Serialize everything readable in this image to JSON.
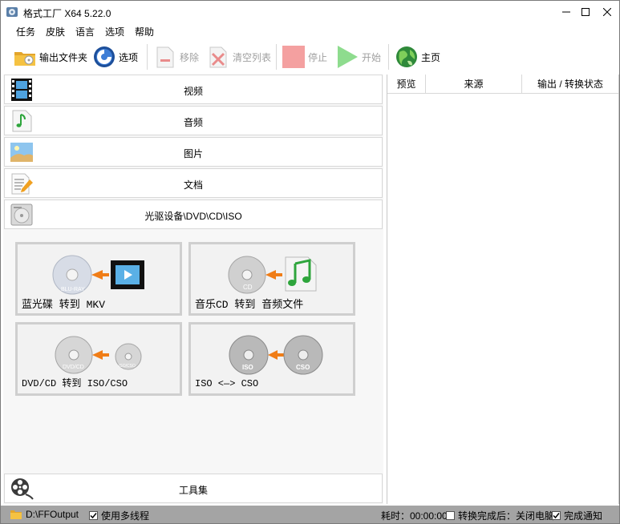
{
  "window": {
    "title": "格式工厂 X64 5.22.0",
    "controls": {
      "minimize": "minimize",
      "maximize": "maximize",
      "close": "close"
    }
  },
  "menu": [
    "任务",
    "皮肤",
    "语言",
    "选项",
    "帮助"
  ],
  "toolbar": {
    "output_folder": "输出文件夹",
    "options": "选项",
    "remove": "移除",
    "clear_list": "清空列表",
    "stop": "停止",
    "start": "开始",
    "home": "主页"
  },
  "categories": {
    "video": "视频",
    "audio": "音频",
    "picture": "图片",
    "document": "文档",
    "optical": "光驱设备\\DVD\\CD\\ISO",
    "tools": "工具集"
  },
  "tiles": {
    "bluray_mkv": "蓝光碟 转到 MKV",
    "musiccd_audio": "音乐CD 转到 音频文件",
    "dvdcd_iso": "DVD/CD 转到 ISO/CSO",
    "iso_cso": "ISO <—> CSO"
  },
  "disc_labels": {
    "bluray": "BLU-RAY",
    "cd": "CD",
    "dvdcd": "DVD/CD",
    "iso_cso_small": "ISO/CSO",
    "iso": "ISO",
    "cso": "CSO"
  },
  "task_list": {
    "columns": {
      "preview": "预览",
      "source": "来源",
      "output_status": "输出 / 转换状态"
    }
  },
  "status": {
    "output_path": "D:\\FFOutput",
    "multithread_label": "使用多线程",
    "multithread_checked": true,
    "elapsed": "耗时：00:00:00",
    "after_convert_label": "转换完成后：关闭电脑",
    "after_convert_checked": false,
    "notify_label": "完成通知",
    "notify_checked": true
  },
  "colors": {
    "statusbar_bg": "#a4a4a4",
    "stop_button": "#f4a0a0",
    "start_button": "#8edc8e",
    "tile_border": "#cfcfcf"
  }
}
